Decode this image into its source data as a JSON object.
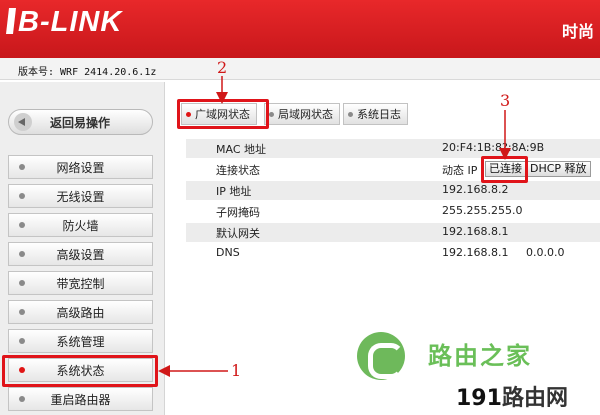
{
  "header": {
    "brand": "B-LINK",
    "right_text": "时尚"
  },
  "version_text": "版本号: WRF 2414.20.6.1z",
  "sidebar": {
    "back_label": "返回易操作",
    "items": [
      {
        "label": "网络设置"
      },
      {
        "label": "无线设置"
      },
      {
        "label": "防火墙"
      },
      {
        "label": "高级设置"
      },
      {
        "label": "带宽控制"
      },
      {
        "label": "高级路由"
      },
      {
        "label": "系统管理"
      },
      {
        "label": "系统状态",
        "active": true
      },
      {
        "label": "重启路由器"
      }
    ]
  },
  "tabs": [
    {
      "label": "广域网状态",
      "active": true
    },
    {
      "label": "局域网状态"
    },
    {
      "label": "系统日志"
    }
  ],
  "status": {
    "mac_label": "MAC 地址",
    "mac_value": "20:F4:1B:8?:8A:9B",
    "conn_label": "连接状态",
    "conn_type": "动态 IP",
    "conn_state": "已连接",
    "dhcp_release": "DHCP 释放",
    "ip_label": "IP 地址",
    "ip_value": "192.168.8.2",
    "mask_label": "子网掩码",
    "mask_value": "255.255.255.0",
    "gw_label": "默认网关",
    "gw_value": "192.168.8.1",
    "dns_label": "DNS",
    "dns_value1": "192.168.8.1",
    "dns_value2": "0.0.0.0"
  },
  "annotations": {
    "n1": "1",
    "n2": "2",
    "n3": "3"
  },
  "watermark": {
    "line1": "路由之家",
    "line2_num": "191",
    "line2_text": "路由网"
  },
  "colors": {
    "header_red": "#d81e20",
    "highlight_red": "#e0141a",
    "watermark_green": "#6abf58"
  }
}
